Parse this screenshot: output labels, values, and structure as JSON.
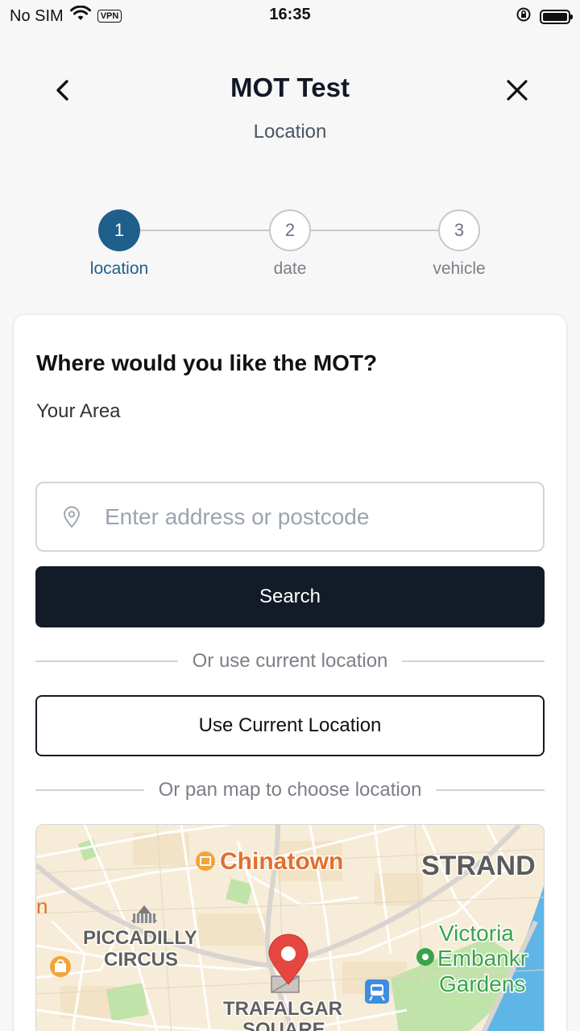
{
  "status_bar": {
    "carrier": "No SIM",
    "vpn": "VPN",
    "time": "16:35"
  },
  "header": {
    "title": "MOT Test",
    "subtitle": "Location"
  },
  "stepper": {
    "steps": [
      {
        "number": "1",
        "label": "location",
        "active": true
      },
      {
        "number": "2",
        "label": "date",
        "active": false
      },
      {
        "number": "3",
        "label": "vehicle",
        "active": false
      }
    ],
    "active_color": "#1f5f8b"
  },
  "form": {
    "heading": "Where would you like the MOT?",
    "area_label": "Your Area",
    "address_placeholder": "Enter address or postcode",
    "address_value": "",
    "search_label": "Search",
    "divider_current": "Or use current location",
    "current_location_label": "Use Current Location",
    "divider_map": "Or pan map to choose location"
  },
  "map": {
    "labels": {
      "chinatown": "Chinatown",
      "strand": "STRAND",
      "piccadilly_1": "PICCADILLY",
      "piccadilly_2": "CIRCUS",
      "victoria_1": "Victoria",
      "victoria_2": "Embankr",
      "victoria_3": "Gardens",
      "trafalgar_1": "TRAFALGAR",
      "trafalgar_2": "SQUARE",
      "edge_left": "n"
    },
    "icons": [
      "chinatown-poi-icon",
      "monument-icon",
      "shopping-icon",
      "park-icon",
      "transit-icon",
      "location-pin-icon"
    ],
    "colors": {
      "land": "#f5ecd9",
      "water": "#5fb6e6",
      "park": "#bfe3a8",
      "pin": "#e5463f",
      "poi_orange": "#f2a33a",
      "park_label": "#3aa34a"
    }
  }
}
